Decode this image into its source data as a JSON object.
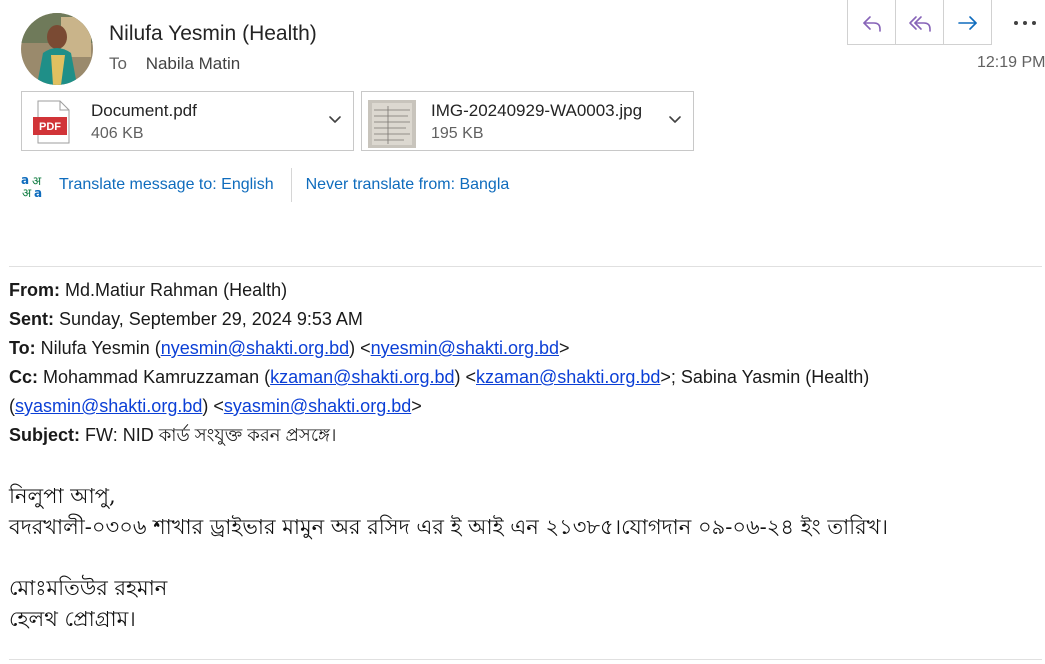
{
  "header": {
    "sender_name": "Nilufa Yesmin (Health)",
    "to_label": "To",
    "to_name": "Nabila Matin",
    "time": "12:19 PM"
  },
  "actions": {
    "reply_icon": "reply-icon",
    "reply_all_icon": "reply-all-icon",
    "forward_icon": "forward-icon",
    "more_icon": "more-icon"
  },
  "attachments": [
    {
      "name": "Document.pdf",
      "size": "406 KB",
      "type_badge": "PDF"
    },
    {
      "name": "IMG-20240929-WA0003.jpg",
      "size": "195 KB"
    }
  ],
  "translate": {
    "translate_label": "Translate message to: English",
    "never_label": "Never translate from: Bangla"
  },
  "forwarded": {
    "from_label": "From:",
    "from_value": "Md.Matiur Rahman (Health)",
    "sent_label": "Sent:",
    "sent_value": "Sunday, September 29, 2024 9:53 AM",
    "to_label": "To:",
    "to_name": "Nilufa Yesmin",
    "to_email": "nyesmin@shakti.org.bd",
    "cc_label": "Cc:",
    "cc1_name": "Mohammad Kamruzzaman",
    "cc1_email": "kzaman@shakti.org.bd",
    "cc2_name": "Sabina Yasmin (Health)",
    "cc2_email": "syasmin@shakti.org.bd",
    "subject_label": "Subject:",
    "subject_value": "FW: NID কার্ড সংযুক্ত করন প্রসঙ্গে।"
  },
  "body": {
    "greeting": "নিলুপা আপু,",
    "line1": "বদরখালী-০৩০৬ শাখার ড্রাইভার মামুন অর রসিদ এর ই আই এন ২১৩৮৫।যোগদান ০৯-০৬-২৪ ইং তারিখ।",
    "signature_name": "মোঃমতিউর রহমান",
    "signature_dept": "হেলথ প্রোগ্রাম।"
  },
  "colors": {
    "accent": "#0f6cbd",
    "link": "#0b3fd6",
    "reply_icon": "#8764b8"
  }
}
